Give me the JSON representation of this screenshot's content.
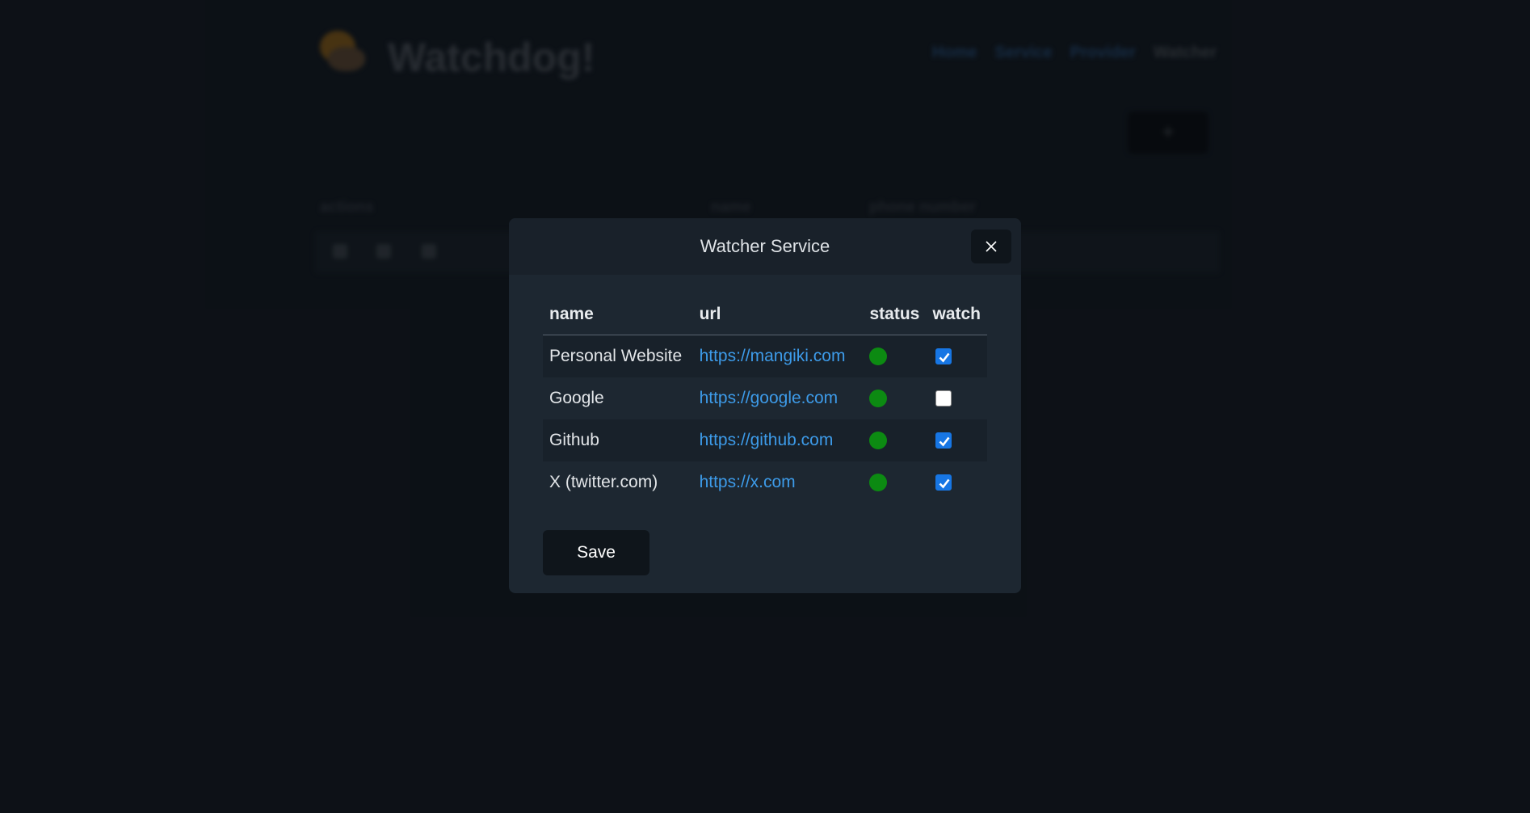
{
  "background": {
    "brand": "Watchdog!",
    "nav": [
      {
        "label": "Home"
      },
      {
        "label": "Service"
      },
      {
        "label": "Provider"
      },
      {
        "label": "Watcher"
      }
    ],
    "add_label": "+",
    "columns": [
      "actions",
      "name",
      "phone number"
    ]
  },
  "modal": {
    "title": "Watcher Service",
    "close_icon": "close-icon",
    "columns": {
      "name": "name",
      "url": "url",
      "status": "status",
      "watch": "watch"
    },
    "rows": [
      {
        "name": "Personal Website",
        "url": "https://mangiki.com",
        "status": "online",
        "watch": true
      },
      {
        "name": "Google",
        "url": "https://google.com",
        "status": "online",
        "watch": false
      },
      {
        "name": "Github",
        "url": "https://github.com",
        "status": "online",
        "watch": true
      },
      {
        "name": "X (twitter.com)",
        "url": "https://x.com",
        "status": "online",
        "watch": true
      }
    ],
    "save_label": "Save"
  },
  "colors": {
    "status_online": "#0c8a12",
    "link": "#3d9be9",
    "checkbox_checked": "#1776e4"
  }
}
